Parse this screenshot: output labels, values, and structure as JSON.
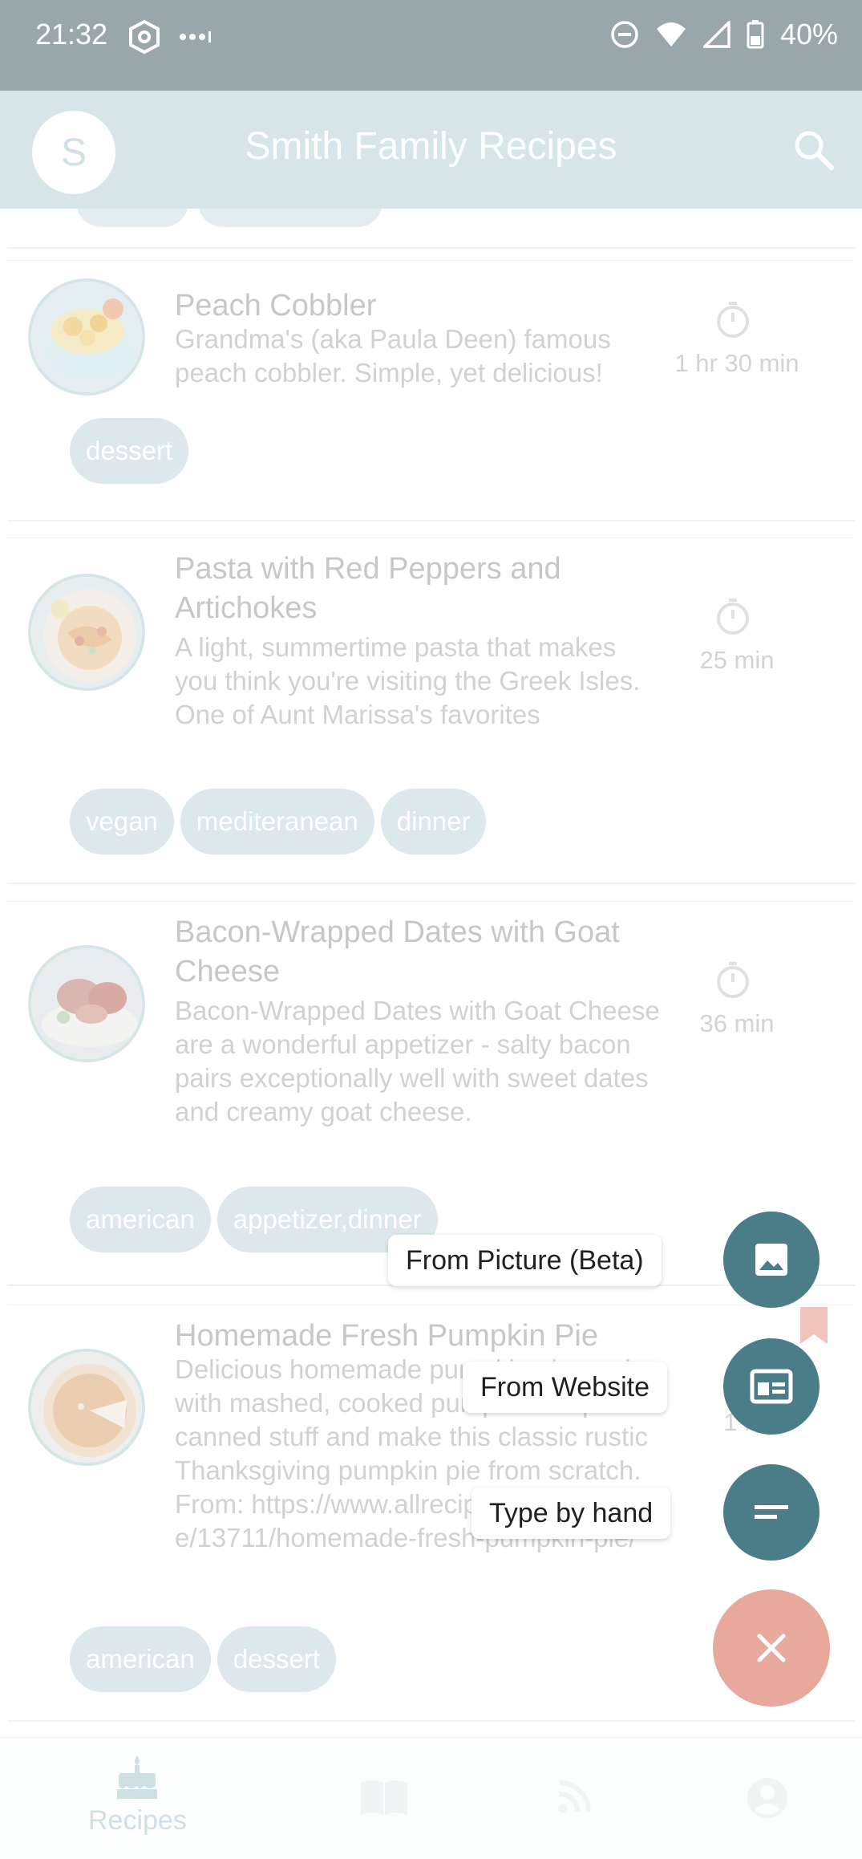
{
  "status_bar": {
    "time": "21:32",
    "battery": "40%",
    "icons": [
      "hexagon-icon",
      "dots-icon",
      "dnd-icon",
      "wifi-icon",
      "signal-icon",
      "battery-icon"
    ]
  },
  "app_bar": {
    "avatar_initial": "S",
    "title": "Smith Family Recipes",
    "search_icon": "search-icon"
  },
  "recipes": [
    {
      "title": "Peach Cobbler",
      "description": "Grandma's (aka Paula Deen) famous peach cobbler. Simple, yet delicious!",
      "time": "1 hr 30 min",
      "tags": [
        "dessert"
      ]
    },
    {
      "title": "Pasta with Red Peppers and Artichokes",
      "description": "A light, summertime pasta that makes you think you're visiting the Greek Isles. One of Aunt Marissa's favorites",
      "time": "25 min",
      "tags": [
        "vegan",
        "mediteranean",
        "dinner"
      ]
    },
    {
      "title": "Bacon-Wrapped Dates with Goat Cheese",
      "description": "Bacon-Wrapped Dates with Goat Cheese are a wonderful appetizer - salty bacon pairs exceptionally well with sweet dates and creamy goat cheese.",
      "time": "36 min",
      "tags": [
        "american",
        "appetizer,dinner"
      ]
    },
    {
      "title": "Homemade Fresh Pumpkin Pie",
      "description": "Delicious homemade pumpkin pie made with mashed, cooked pumpkin. Skip the canned stuff and make this classic rustic Thanksgiving pumpkin pie from scratch.",
      "source": "From: https://www.allrecipes.com/recipe/13711/homemade-fresh-pumpkin-pie/",
      "time": "1 hr",
      "tags": [
        "american",
        "dessert"
      ]
    }
  ],
  "fab_menu": {
    "picture_label": "From Picture (Beta)",
    "website_label": "From Website",
    "hand_label": "Type by hand",
    "close_icon": "close-icon"
  },
  "bottom_nav": {
    "recipes_label": "Recipes",
    "items": [
      "cake-icon",
      "book-icon",
      "rss-icon",
      "account-icon"
    ]
  },
  "colors": {
    "status_bar": "#9aa7aa",
    "app_bar": "#d7e5e8",
    "fab": "#4b7d88",
    "fab_close": "#e8a89b",
    "tag": "#dce8eb"
  }
}
